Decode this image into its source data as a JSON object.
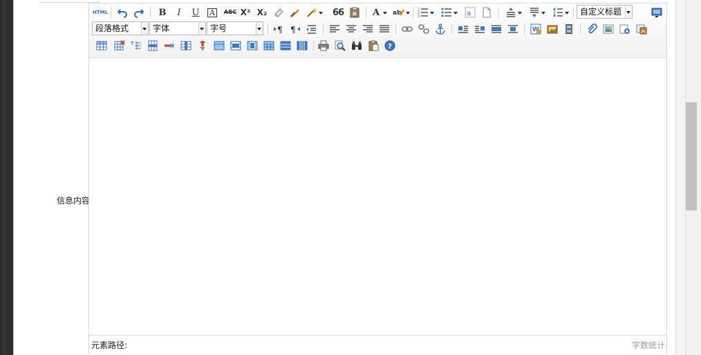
{
  "form": {
    "content_label": "信息内容："
  },
  "editor": {
    "toolbar": {
      "html_button": "HTML",
      "bold": "B",
      "italic": "I",
      "underline": "U",
      "font_border": "A",
      "strike": "ABC",
      "superscript": "X²",
      "subscript": "X₂",
      "blockquote": "66",
      "font_color": "A",
      "paragraph_select": "段落格式",
      "font_select": "字体",
      "fontsize_select": "字号",
      "custom_title_select": "自定义标题"
    },
    "statusbar": {
      "path_label": "元素路径:",
      "word_count": "字数统计"
    }
  },
  "colors": {
    "icon_blue": "#2a6fc9",
    "icon_gold": "#d39b25",
    "icon_red": "#c63a2a",
    "background_dark": "#2e2e2e"
  }
}
